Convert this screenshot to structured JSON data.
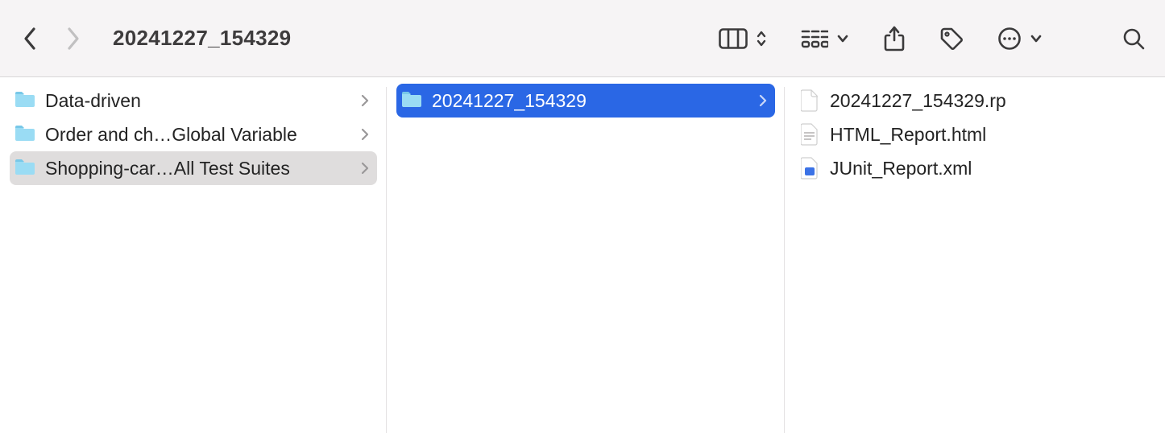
{
  "header": {
    "title": "20241227_154329"
  },
  "columns": [
    {
      "items": [
        {
          "name": "Data-driven",
          "type": "folder",
          "selected": false
        },
        {
          "name": "Order and ch…Global Variable",
          "type": "folder",
          "selected": false
        },
        {
          "name": "Shopping-car…All Test Suites",
          "type": "folder",
          "selected": "gray"
        }
      ]
    },
    {
      "items": [
        {
          "name": "20241227_154329",
          "type": "folder",
          "selected": "blue"
        }
      ]
    },
    {
      "items": [
        {
          "name": "20241227_154329.rp",
          "type": "file-blank",
          "selected": false
        },
        {
          "name": "HTML_Report.html",
          "type": "file-html",
          "selected": false
        },
        {
          "name": "JUnit_Report.xml",
          "type": "file-xml",
          "selected": false
        }
      ]
    }
  ]
}
